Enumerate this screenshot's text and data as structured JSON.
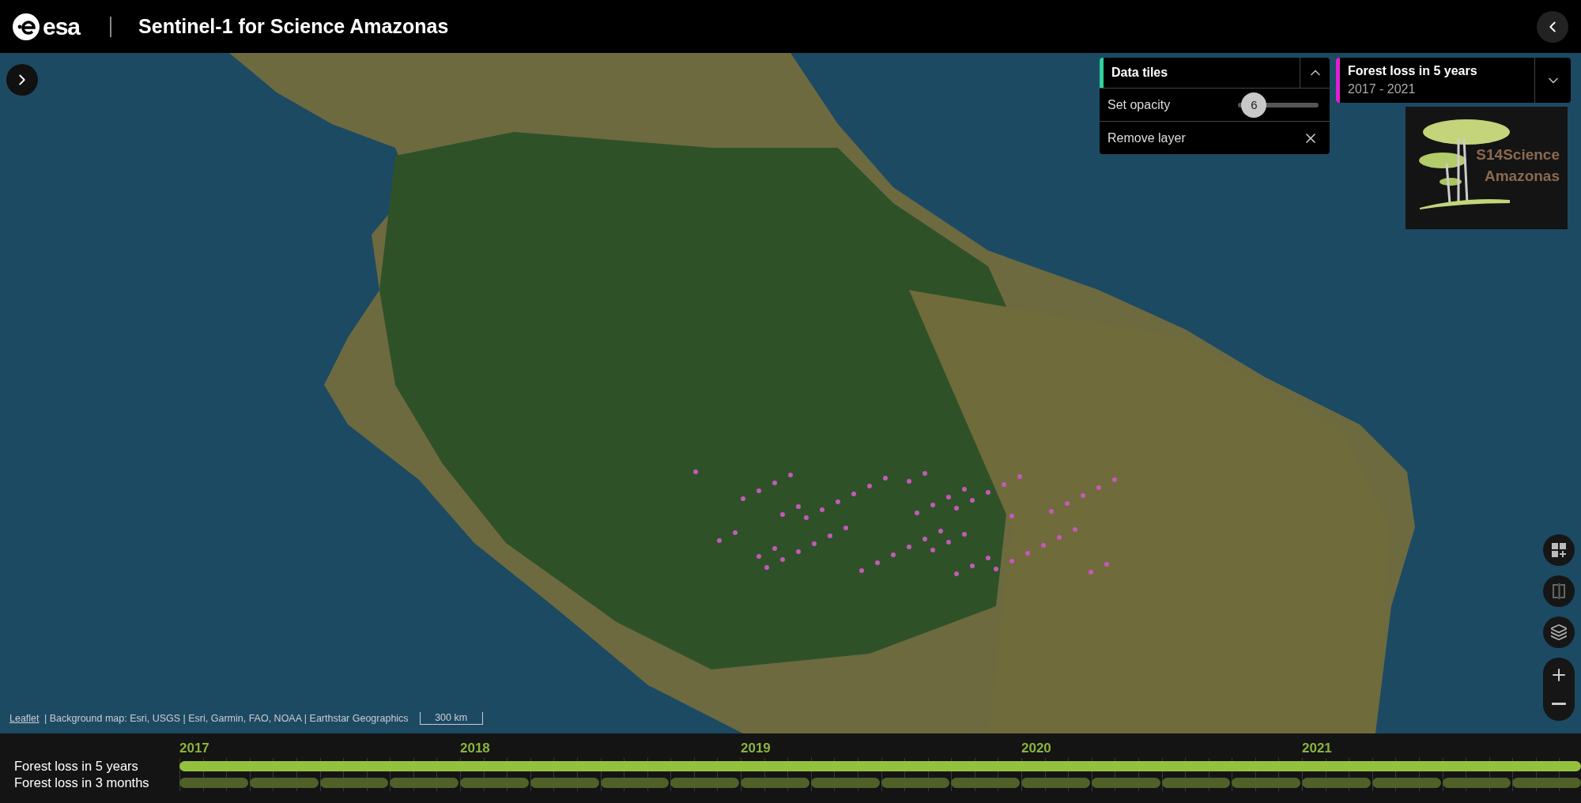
{
  "header": {
    "logo": "esa",
    "title": "Sentinel-1 for Science Amazonas"
  },
  "layer_controls": {
    "title": "Data tiles",
    "color": "#2fd29a",
    "expanded": true,
    "opacity": {
      "label": "Set opacity",
      "value": "6",
      "level": 0.2
    },
    "remove": {
      "label": "Remove layer"
    }
  },
  "active_layer": {
    "title": "Forest loss in 5 years",
    "subtitle": "2017 - 2021",
    "color": "#e020d0",
    "expanded": false
  },
  "project_logo": {
    "line_1": "S14Science",
    "line_2": "Amazonas"
  },
  "attribution": {
    "link": "Leaflet",
    "text": "| Background map: Esri, USGS | Esri, Garmin, FAO, NOAA | Earthstar Geographics"
  },
  "scale": "300 km",
  "timeline": {
    "years": [
      "2017",
      "2018",
      "2019",
      "2020",
      "2021"
    ],
    "rows": [
      {
        "label": "Forest loss in 5 years",
        "kind": "span",
        "selected": true
      },
      {
        "label": "Forest loss in 3 months",
        "kind": "quarters",
        "selected": false
      }
    ]
  }
}
